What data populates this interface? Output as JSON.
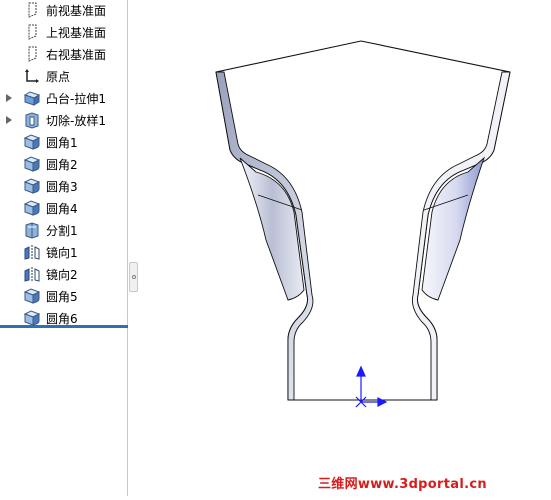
{
  "feature_tree": {
    "items": [
      {
        "label": "前视基准面",
        "icon": "plane-icon"
      },
      {
        "label": "上视基准面",
        "icon": "plane-icon"
      },
      {
        "label": "右视基准面",
        "icon": "plane-icon"
      },
      {
        "label": "原点",
        "icon": "origin-icon"
      },
      {
        "label": "凸台-拉伸1",
        "icon": "extrude-icon",
        "expandable": true
      },
      {
        "label": "切除-放样1",
        "icon": "cut-loft-icon",
        "expandable": true
      },
      {
        "label": "圆角1",
        "icon": "fillet-icon"
      },
      {
        "label": "圆角2",
        "icon": "fillet-icon"
      },
      {
        "label": "圆角3",
        "icon": "fillet-icon"
      },
      {
        "label": "圆角4",
        "icon": "fillet-icon"
      },
      {
        "label": "分割1",
        "icon": "split-icon"
      },
      {
        "label": "镜向1",
        "icon": "mirror-icon"
      },
      {
        "label": "镜向2",
        "icon": "mirror-icon"
      },
      {
        "label": "圆角5",
        "icon": "fillet-icon"
      },
      {
        "label": "圆角6",
        "icon": "fillet-icon"
      }
    ]
  },
  "watermark": {
    "text": "三维网www.3dportal.cn"
  },
  "colors": {
    "rollback_bar": "#2f6fb7",
    "triad_axis": "#1a1aff",
    "watermark": "#d81c1c"
  }
}
